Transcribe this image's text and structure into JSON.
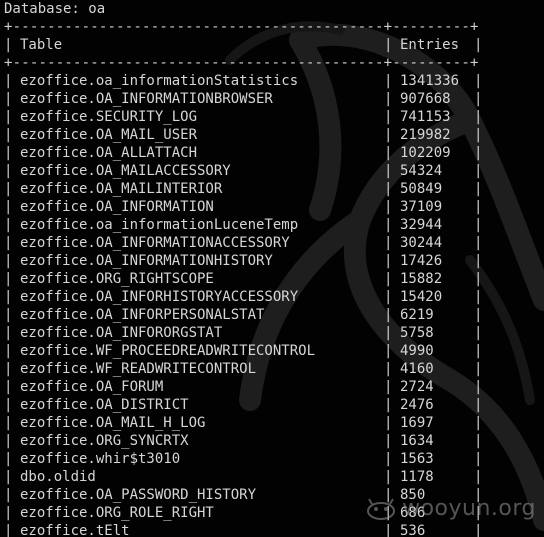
{
  "terminal": {
    "database_line": "Database: oa",
    "border_top": "+-------------------------------------------+---------+",
    "border_mid": "+-------------------------------------------+---------+",
    "header": {
      "col_table": "Table",
      "col_entries": "Entries"
    },
    "rows": [
      {
        "table": "ezoffice.oa_informationStatistics",
        "entries": "1341336"
      },
      {
        "table": "ezoffice.OA_INFORMATIONBROWSER",
        "entries": "907668"
      },
      {
        "table": "ezoffice.SECURITY_LOG",
        "entries": "741153"
      },
      {
        "table": "ezoffice.OA_MAIL_USER",
        "entries": "219982"
      },
      {
        "table": "ezoffice.OA_ALLATTACH",
        "entries": "102209"
      },
      {
        "table": "ezoffice.OA_MAILACCESSORY",
        "entries": "54324"
      },
      {
        "table": "ezoffice.OA_MAILINTERIOR",
        "entries": "50849"
      },
      {
        "table": "ezoffice.OA_INFORMATION",
        "entries": "37109"
      },
      {
        "table": "ezoffice.oa_informationLuceneTemp",
        "entries": "32944"
      },
      {
        "table": "ezoffice.OA_INFORMATIONACCESSORY",
        "entries": "30244"
      },
      {
        "table": "ezoffice.OA_INFORMATIONHISTORY",
        "entries": "17426"
      },
      {
        "table": "ezoffice.ORG_RIGHTSCOPE",
        "entries": "15882"
      },
      {
        "table": "ezoffice.OA_INFORHISTORYACCESSORY",
        "entries": "15420"
      },
      {
        "table": "ezoffice.OA_INFORPERSONALSTAT",
        "entries": "6219"
      },
      {
        "table": "ezoffice.OA_INFORORGSTAT",
        "entries": "5758"
      },
      {
        "table": "ezoffice.WF_PROCEEDREADWRITECONTROL",
        "entries": "4990"
      },
      {
        "table": "ezoffice.WF_READWRITECONTROL",
        "entries": "4160"
      },
      {
        "table": "ezoffice.OA_FORUM",
        "entries": "2724"
      },
      {
        "table": "ezoffice.OA_DISTRICT",
        "entries": "2476"
      },
      {
        "table": "ezoffice.OA_MAIL_H_LOG",
        "entries": "1697"
      },
      {
        "table": "ezoffice.ORG_SYNCRTX",
        "entries": "1634"
      },
      {
        "table": "ezoffice.whir$t3010",
        "entries": "1563"
      },
      {
        "table": "dbo.oldid",
        "entries": "1178"
      },
      {
        "table": "ezoffice.OA_PASSWORD_HISTORY",
        "entries": "850"
      },
      {
        "table": "ezoffice.ORG_ROLE_RIGHT",
        "entries": "686"
      },
      {
        "table": "ezoffice.tElt",
        "entries": "536"
      }
    ]
  },
  "watermark": {
    "text": "wooyun.org",
    "icon": "wooyun-logo-icon"
  },
  "colors": {
    "background": "#020202",
    "text": "#d6d6d6",
    "dragon": "#1c1c1c"
  }
}
